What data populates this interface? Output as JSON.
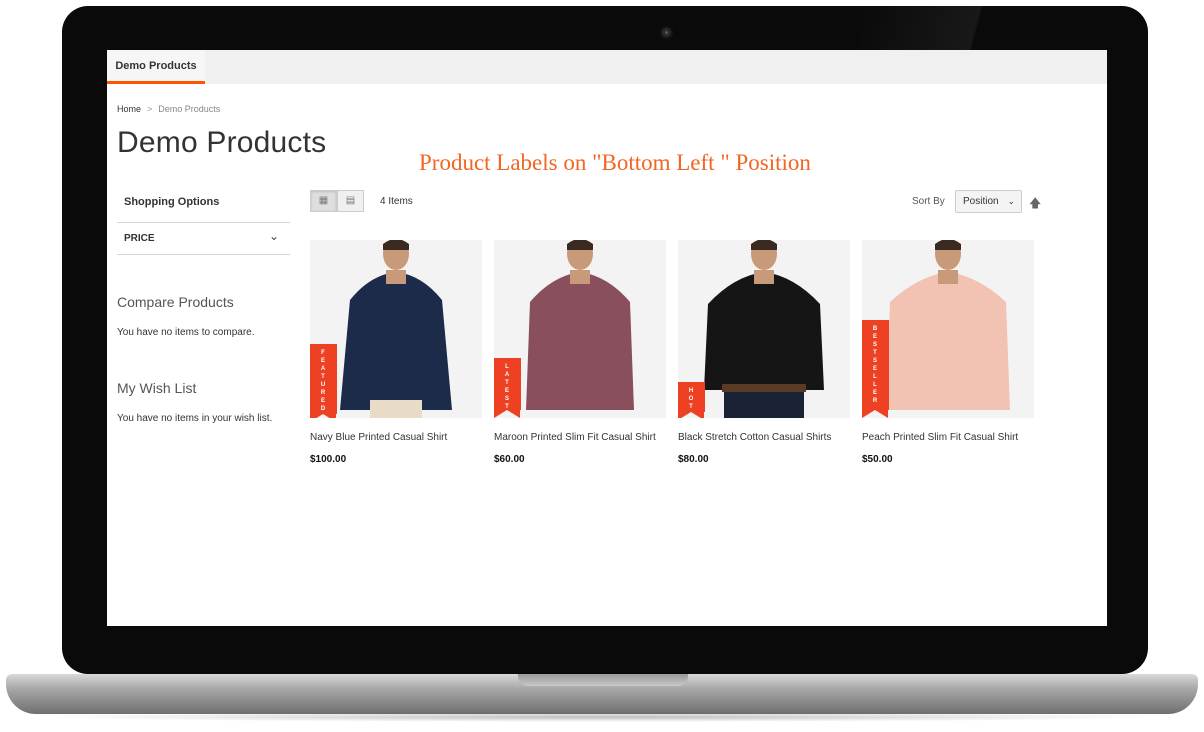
{
  "header": {
    "tab_label": "Demo Products"
  },
  "breadcrumb": {
    "home": "Home",
    "separator": ">",
    "current": "Demo Products"
  },
  "page": {
    "title": "Demo Products",
    "promo_text": "Product Labels on \"Bottom Left \" Position"
  },
  "sidebar": {
    "shopping_options": "Shopping Options",
    "price_filter": "PRICE",
    "compare_title": "Compare Products",
    "compare_empty": "You have no items to compare.",
    "wishlist_title": "My Wish List",
    "wishlist_empty": "You have no items in your wish list."
  },
  "toolbar": {
    "items_count": "4 Items",
    "sort_label": "Sort By",
    "sort_value": "Position",
    "view_modes": [
      "grid",
      "list"
    ]
  },
  "products": [
    {
      "name": "Navy Blue Printed Casual Shirt",
      "price": "$100.00",
      "label": "FEATURED",
      "shirt_color": "#1d2b4a"
    },
    {
      "name": "Maroon Printed Slim Fit Casual Shirt",
      "price": "$60.00",
      "label": "LATEST",
      "shirt_color": "#8a4f5c"
    },
    {
      "name": "Black Stretch Cotton Casual Shirts",
      "price": "$80.00",
      "label": "HOT",
      "shirt_color": "#151515"
    },
    {
      "name": "Peach Printed Slim Fit Casual Shirt",
      "price": "$50.00",
      "label": "BEST SELLER",
      "shirt_color": "#f2c2b3"
    }
  ],
  "colors": {
    "accent": "#ff5501",
    "promo": "#f26522",
    "label_ribbon": "#ee4123"
  }
}
